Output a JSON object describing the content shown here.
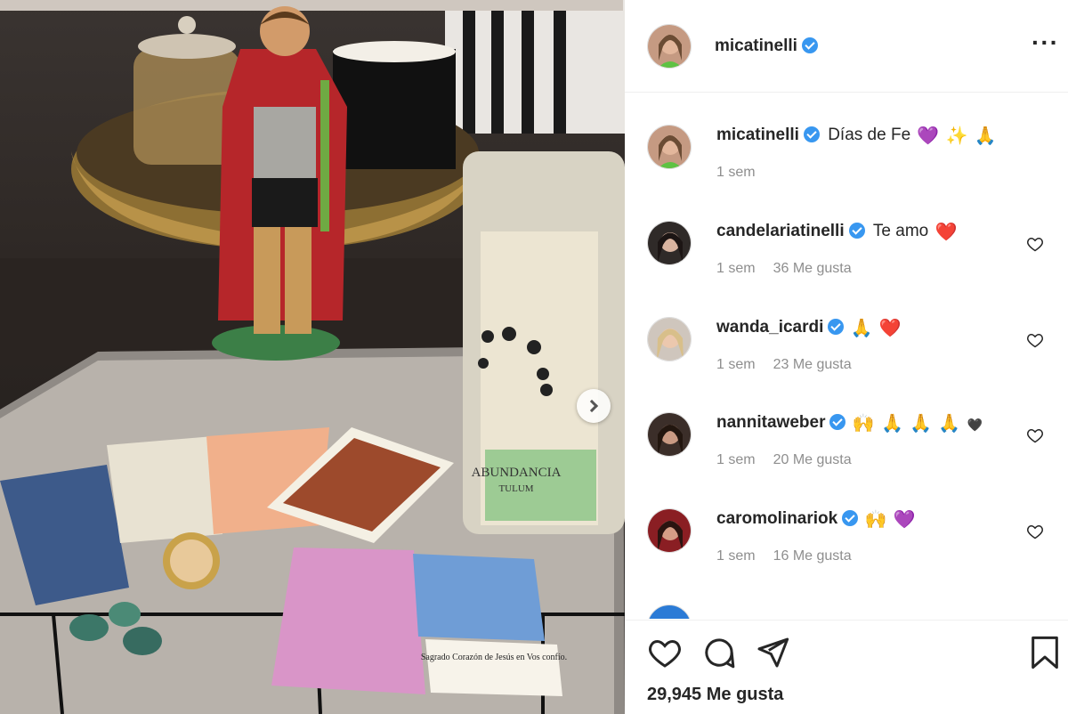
{
  "post": {
    "author": "micatinelli",
    "likes_label": "29,945 Me gusta"
  },
  "caption": {
    "user": "micatinelli",
    "text": "Días de Fe",
    "emoji": [
      "💜",
      "✨",
      "🙏"
    ],
    "time": "1 sem"
  },
  "comments": [
    {
      "user": "candelariatinelli",
      "verified": true,
      "text": "Te amo",
      "emoji": [
        "❤️"
      ],
      "time": "1 sem",
      "likes": "36 Me gusta"
    },
    {
      "user": "wanda_icardi",
      "verified": true,
      "text": "",
      "emoji": [
        "🙏",
        "❤️"
      ],
      "time": "1 sem",
      "likes": "23 Me gusta"
    },
    {
      "user": "nannitaweber",
      "verified": true,
      "text": "",
      "emoji": [
        "🙌",
        "🙏",
        "🙏",
        "🙏",
        "🖤"
      ],
      "time": "1 sem",
      "likes": "20 Me gusta"
    },
    {
      "user": "caromolinariok",
      "verified": true,
      "text": "",
      "emoji": [
        "🙌",
        "💜"
      ],
      "time": "1 sem",
      "likes": "16 Me gusta"
    }
  ],
  "photo": {
    "card_labels": [
      "ABUNDANCIA",
      "TULUM",
      "Sagrado Corazón de Jesús en Vos confío."
    ]
  },
  "icons": {
    "more": "more-options-icon",
    "like": "heart-icon",
    "comment": "comment-icon",
    "share": "paper-plane-icon",
    "save": "bookmark-icon",
    "next": "chevron-right-icon",
    "verified": "verified-badge-icon"
  },
  "colors": {
    "verified": "#3897f0",
    "muted_text": "#8e8e8e",
    "divider": "#efefef"
  }
}
